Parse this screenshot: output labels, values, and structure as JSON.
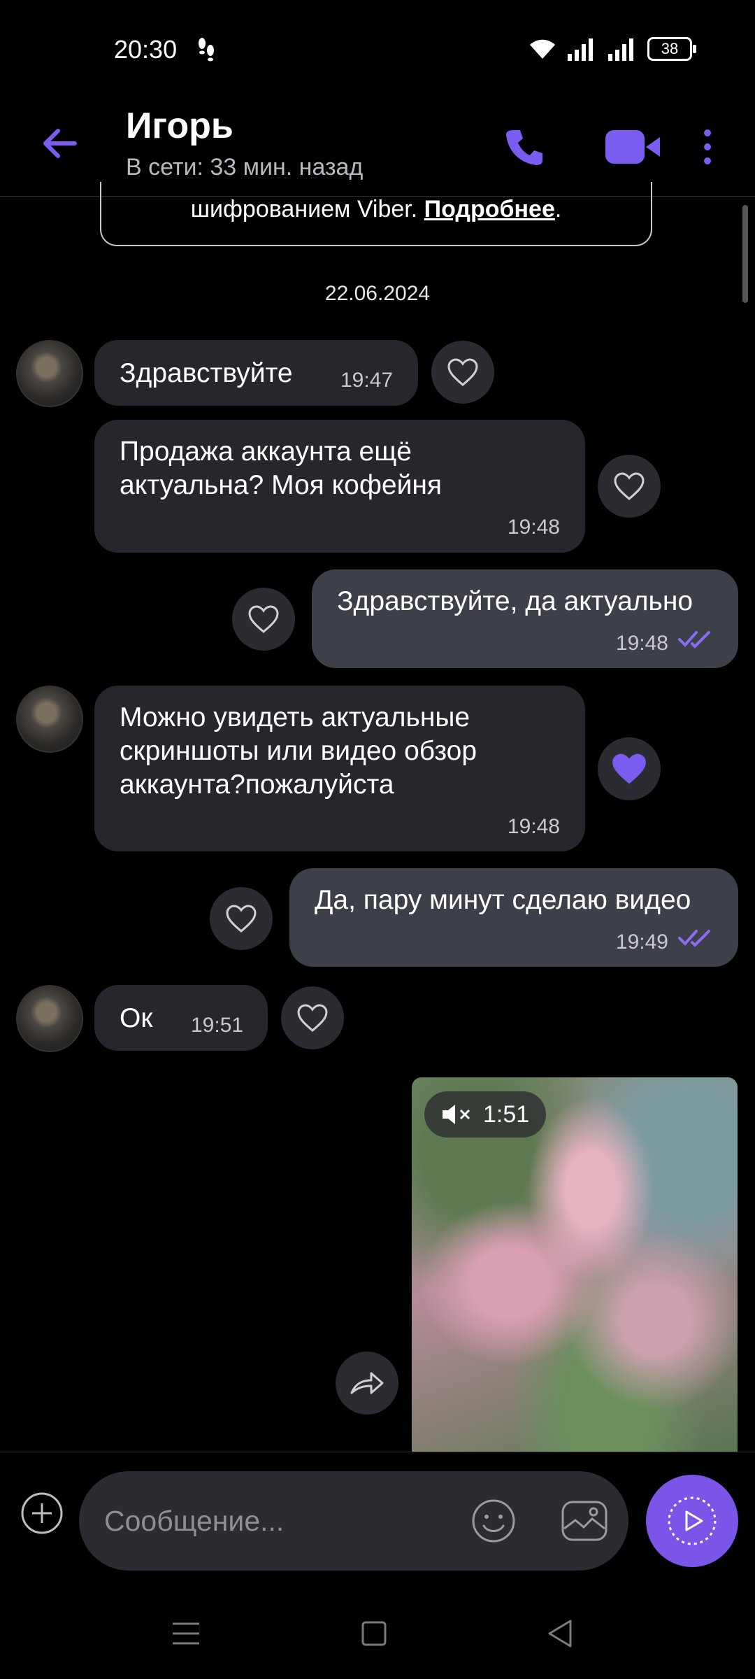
{
  "status_bar": {
    "time": "20:30",
    "battery": "38",
    "steps_icon": "footsteps-icon",
    "icons": [
      "wifi-icon",
      "signal-icon",
      "signal-icon"
    ]
  },
  "header": {
    "contact_name": "Игорь",
    "last_seen": "В сети: 33 мин. назад",
    "icons": [
      "back-arrow-icon",
      "phone-icon",
      "video-camera-icon",
      "more-vert-icon"
    ],
    "accent_color": "#7b5cf0"
  },
  "encryption_notice": {
    "text": "шифрованием Viber.",
    "link": "Подробнее",
    "end": "."
  },
  "date_separator": "22.06.2024",
  "messages": [
    {
      "direction": "in",
      "text": "Здравствуйте",
      "time": "19:47",
      "liked": false
    },
    {
      "direction": "in",
      "text": "Продажа аккаунта ещё актуальна? Моя кофейня",
      "time": "19:48",
      "liked": false
    },
    {
      "direction": "out",
      "text": "Здравствуйте, да актуально",
      "time": "19:48",
      "read": true,
      "liked": false
    },
    {
      "direction": "in",
      "text": "Можно увидеть актуальные скриншоты или видео обзор аккаунта?пожалуйста",
      "time": "19:48",
      "liked": true
    },
    {
      "direction": "out",
      "text": "Да, пару минут сделаю видео",
      "time": "19:49",
      "read": true,
      "liked": false
    },
    {
      "direction": "in",
      "text": "Ок",
      "time": "19:51",
      "liked": false
    }
  ],
  "video_message": {
    "duration": "1:51",
    "muted": true
  },
  "input": {
    "placeholder": "Сообщение...",
    "icons": [
      "plus-icon",
      "emoji-icon",
      "gallery-icon",
      "send-icon"
    ]
  },
  "nav_bar": {
    "icons": [
      "menu-icon",
      "home-icon",
      "back-icon"
    ]
  }
}
